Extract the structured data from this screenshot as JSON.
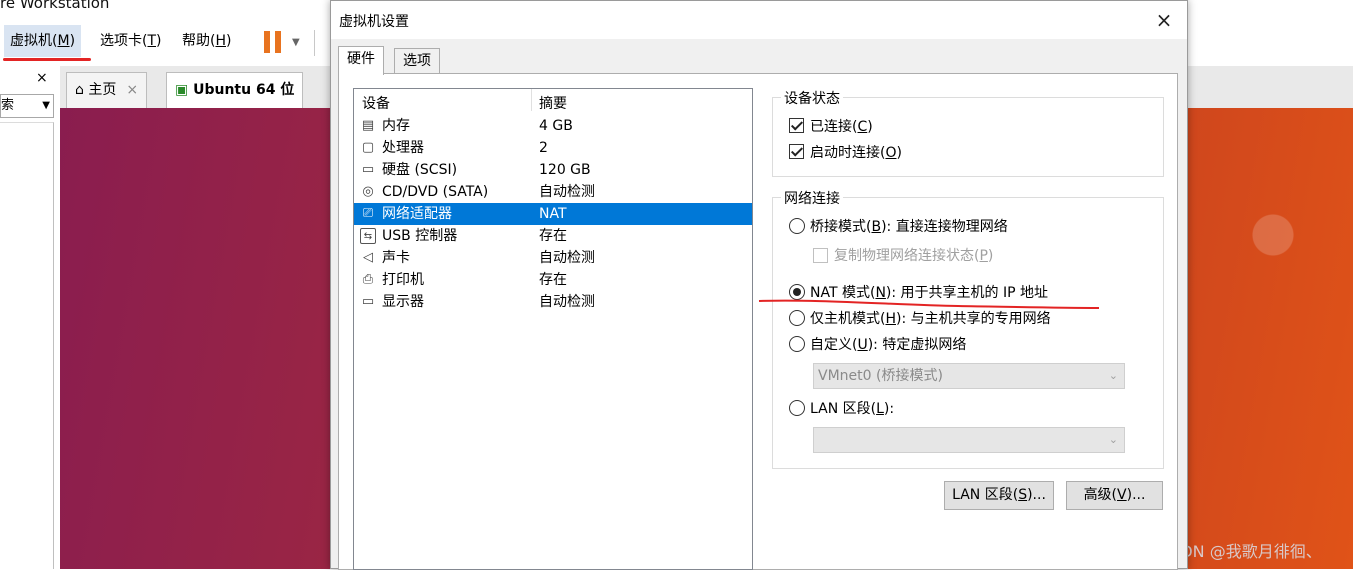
{
  "app": {
    "title": "re Workstation",
    "menu": [
      {
        "label": "虚拟机(",
        "key": "M",
        "tail": ")"
      },
      {
        "label": "选项卡(",
        "key": "T",
        "tail": ")"
      },
      {
        "label": "帮助(",
        "key": "H",
        "tail": ")"
      }
    ],
    "left_panel": {
      "close": "×",
      "search_text": "索"
    },
    "tabs": [
      {
        "label": "主页",
        "close": "×"
      },
      {
        "label": "Ubuntu 64 位",
        "close": "×"
      }
    ],
    "watermark": "CSDN @我歌月徘徊、",
    "annotation_color": "#e32424"
  },
  "dialog": {
    "title": "虚拟机设置",
    "close": "×",
    "tabs": [
      "硬件",
      "选项"
    ],
    "device_list": {
      "headers": [
        "设备",
        "摘要"
      ],
      "rows": [
        {
          "name": "内存",
          "summary": "4 GB",
          "icon": "memory-icon"
        },
        {
          "name": "处理器",
          "summary": "2",
          "icon": "cpu-icon"
        },
        {
          "name": "硬盘 (SCSI)",
          "summary": "120 GB",
          "icon": "hard-disk-icon"
        },
        {
          "name": "CD/DVD (SATA)",
          "summary": "自动检测",
          "icon": "cd-dvd-icon"
        },
        {
          "name": "网络适配器",
          "summary": "NAT",
          "icon": "network-adapter-icon",
          "selected": true
        },
        {
          "name": "USB 控制器",
          "summary": "存在",
          "icon": "usb-icon"
        },
        {
          "name": "声卡",
          "summary": "自动检测",
          "icon": "speaker-icon"
        },
        {
          "name": "打印机",
          "summary": "存在",
          "icon": "printer-icon"
        },
        {
          "name": "显示器",
          "summary": "自动检测",
          "icon": "monitor-icon"
        }
      ]
    },
    "device_status": {
      "legend": "设备状态",
      "connected": {
        "label": "已连接(",
        "key": "C",
        "tail": ")",
        "checked": true
      },
      "connect_on_power_on": {
        "label": "启动时连接(",
        "key": "O",
        "tail": ")",
        "checked": true
      }
    },
    "network_connection": {
      "legend": "网络连接",
      "bridged": {
        "label": "桥接模式(",
        "key": "B",
        "tail": "): 直接连接物理网络",
        "checked": false
      },
      "replicate": {
        "label": "复制物理网络连接状态(",
        "key": "P",
        "tail": ")",
        "checked": false
      },
      "nat": {
        "label": "NAT 模式(",
        "key": "N",
        "tail": "): 用于共享主机的 IP 地址",
        "checked": true
      },
      "host_only": {
        "label": "仅主机模式(",
        "key": "H",
        "tail": "): 与主机共享的专用网络",
        "checked": false
      },
      "custom": {
        "label": "自定义(",
        "key": "U",
        "tail": "): 特定虚拟网络",
        "checked": false
      },
      "vmnet_select": "VMnet0 (桥接模式)",
      "lan_segment": {
        "label": "LAN 区段(",
        "key": "L",
        "tail": "):",
        "checked": false
      },
      "lan_select": ""
    },
    "buttons": {
      "lan_segments": {
        "label": "LAN 区段(",
        "key": "S",
        "tail": ")..."
      },
      "advanced": {
        "label": "高级(",
        "key": "V",
        "tail": ")..."
      }
    }
  }
}
